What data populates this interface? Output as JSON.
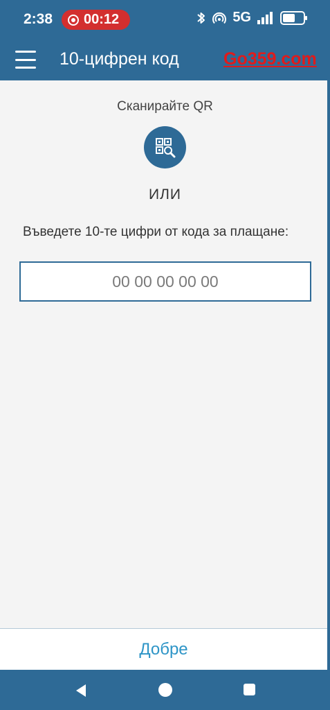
{
  "status_bar": {
    "time": "2:38",
    "recording_timer": "00:12",
    "network": "5G",
    "icons": [
      "bluetooth-icon",
      "hotspot-icon",
      "signal-icon",
      "battery-icon"
    ]
  },
  "app_bar": {
    "title": "10-цифрен код",
    "watermark": "Go359.com"
  },
  "main": {
    "scan_label": "Сканирайте QR",
    "qr_button_icon": "qr-scan-icon",
    "or_label": "ИЛИ",
    "prompt": "Въведете 10-те цифри от кода за плащане:",
    "code_input": {
      "value": "",
      "placeholder": "00 00 00 00 00"
    }
  },
  "footer": {
    "ok_label": "Добре"
  },
  "nav_bar": {
    "icons": [
      "back-icon",
      "home-icon",
      "recents-icon"
    ]
  },
  "colors": {
    "primary": "#2e6a96",
    "accent_link": "#2e95c7",
    "record_badge": "#d32f2f",
    "watermark": "#e01b1b",
    "background": "#f4f4f4"
  }
}
